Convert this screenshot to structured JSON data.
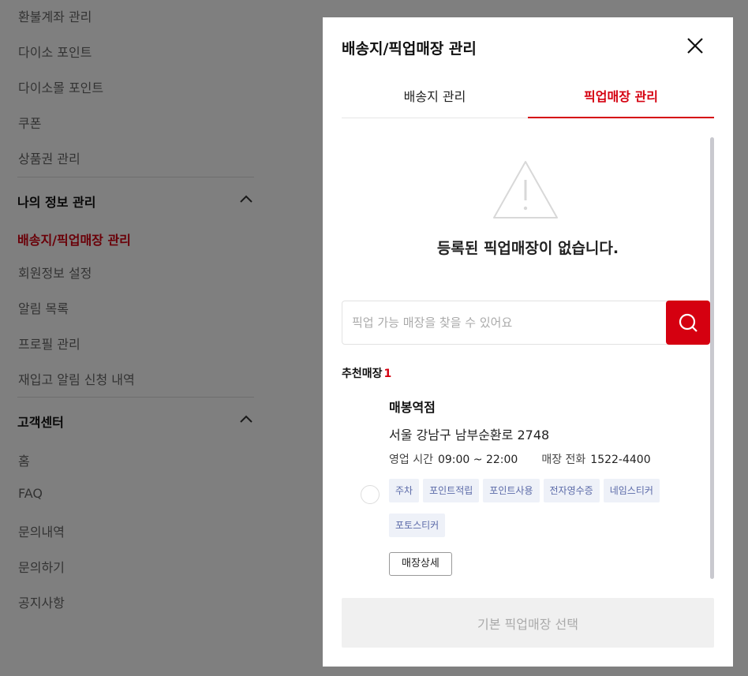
{
  "sidebar": {
    "top_items": [
      "환불계좌 관리",
      "다이소 포인트",
      "다이소몰 포인트",
      "쿠폰",
      "상품권 관리"
    ],
    "section1": {
      "title": "나의 정보 관리",
      "items": [
        "배송지/픽업매장 관리",
        "회원정보 설정",
        "알림 목록",
        "프로필 관리",
        "재입고 알림 신청 내역"
      ]
    },
    "section2": {
      "title": "고객센터",
      "items": [
        "홈",
        "FAQ",
        "문의내역",
        "문의하기",
        "공지사항"
      ]
    }
  },
  "modal": {
    "title": "배송지/픽업매장 관리",
    "tabs": [
      "배송지 관리",
      "픽업매장 관리"
    ],
    "active_tab": 1,
    "empty_message": "등록된 픽업매장이 없습니다.",
    "search": {
      "placeholder": "픽업 가능 매장을 찾을 수 있어요",
      "value": ""
    },
    "recommend": {
      "label": "추천매장",
      "count": "1"
    },
    "store": {
      "name": "매봉역점",
      "address": "서울 강남구 남부순환로 2748",
      "hours_label": "영업 시간",
      "hours": "09:00 ~ 22:00",
      "phone_label": "매장 전화",
      "phone": "1522-4400",
      "tags": [
        "주차",
        "포인트적립",
        "포인트사용",
        "전자영수증",
        "네임스티커",
        "포토스티커"
      ],
      "detail_button": "매장상세"
    },
    "select_button": "기본 픽업매장 선택"
  },
  "colors": {
    "accent": "#d50010",
    "tag_bg": "#eef1f8",
    "tag_text": "#5b6aa8"
  }
}
